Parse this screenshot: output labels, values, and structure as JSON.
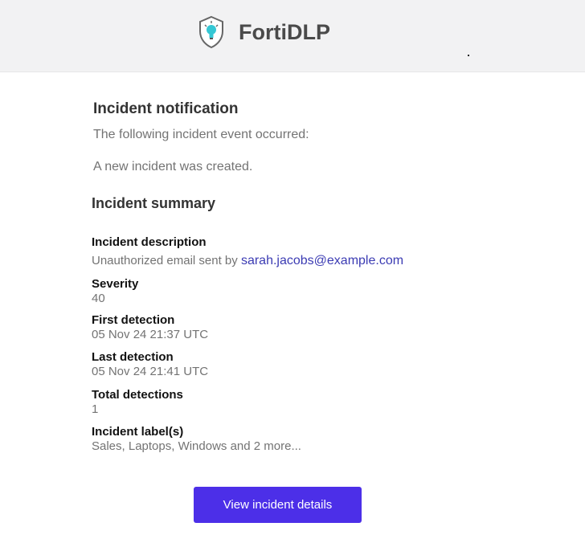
{
  "header": {
    "brand": "FortiDLP",
    "logo_icon": "shield-lightbulb-icon",
    "accent_color": "#35c7d4"
  },
  "notification": {
    "title": "Incident notification",
    "intro": "The following incident event occurred:",
    "event": "A new incident was created."
  },
  "summary": {
    "title": "Incident summary",
    "description_label": "Incident description",
    "description_prefix": "Unauthorized email sent by",
    "description_email": "sarah.jacobs@example.com",
    "severity_label": "Severity",
    "severity_value": "40",
    "first_detection_label": "First detection",
    "first_detection_value": "05 Nov 24 21:37 UTC",
    "last_detection_label": "Last detection",
    "last_detection_value": "05 Nov 24 21:41 UTC",
    "total_detections_label": "Total detections",
    "total_detections_value": "1",
    "labels_label": "Incident label(s)",
    "labels_value": "Sales, Laptops, Windows and 2 more..."
  },
  "cta": {
    "label": "View incident details",
    "color": "#4c2fe8"
  }
}
